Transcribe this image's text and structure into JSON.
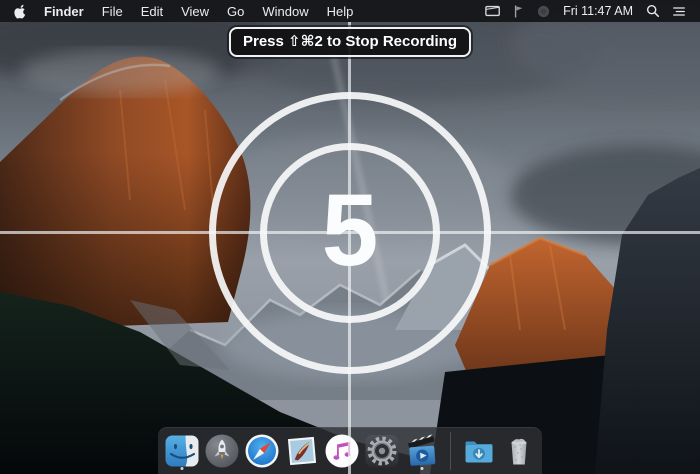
{
  "menubar": {
    "apple_icon": "apple-logo-icon",
    "menus": [
      "Finder",
      "File",
      "Edit",
      "View",
      "Go",
      "Window",
      "Help"
    ],
    "active_app": "Finder",
    "status": {
      "icons": [
        "screen-recording-icon",
        "flag-icon",
        "dimmed-record-icon",
        "spotlight-search-icon",
        "notification-center-icon"
      ],
      "clock": "Fri 11:47 AM"
    }
  },
  "recording_banner": {
    "text": "Press ⇧⌘2 to Stop Recording"
  },
  "countdown": {
    "value": "5"
  },
  "dock": {
    "items": [
      {
        "name": "Finder",
        "running": true
      },
      {
        "name": "Launchpad",
        "running": false
      },
      {
        "name": "Safari",
        "running": false
      },
      {
        "name": "Mail",
        "running": false
      },
      {
        "name": "iTunes",
        "running": false
      },
      {
        "name": "System Preferences",
        "running": false
      },
      {
        "name": "ScreenFlow",
        "running": true
      },
      {
        "name": "Downloads",
        "running": false
      },
      {
        "name": "Trash",
        "running": false
      }
    ]
  },
  "colors": {
    "menubar_bg": "#17181b",
    "banner_border": "#f1f2f3",
    "countdown_white": "#fbfcfd",
    "dock_bg": "rgba(46,48,51,0.80)",
    "cliff_orange": "#a85627",
    "sky_gray": "#99a0a9"
  }
}
